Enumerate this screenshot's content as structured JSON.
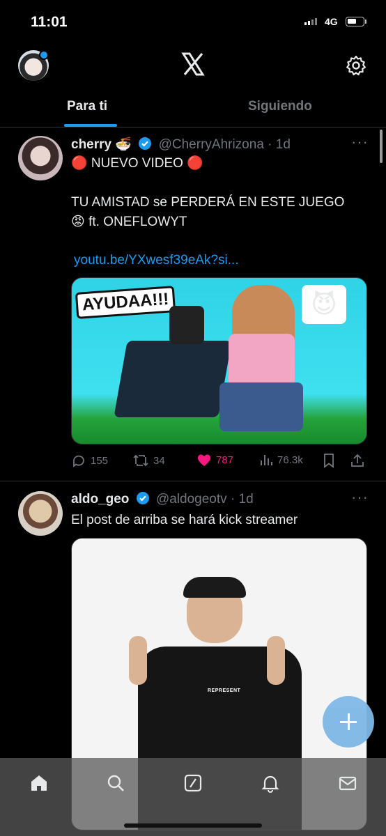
{
  "status_bar": {
    "time": "11:01",
    "network": "4G"
  },
  "header": {
    "logo": "X",
    "settings_icon": "gear-icon"
  },
  "tabs": [
    {
      "label": "Para ti",
      "active": true
    },
    {
      "label": "Siguiendo",
      "active": false
    }
  ],
  "posts": [
    {
      "name": "cherry 🍜",
      "handle": "@CherryAhrizona",
      "time": "· 1d",
      "lines": [
        "🔴 NUEVO VIDEO 🔴",
        "TU AMISTAD se PERDERÁ EN ESTE JUEGO",
        "😡 ft. ONEFLOWYT"
      ],
      "link": "youtu.be/YXwesf39eAk?si...",
      "media_caption": "AYUDAA!!!",
      "actions": {
        "replies": "155",
        "reposts": "34",
        "likes": "787",
        "views": "76.3k"
      }
    },
    {
      "name": "aldo_geo",
      "handle": "@aldogeotv",
      "time": "· 1d",
      "text": "El post de arriba se hará kick streamer",
      "media_shirt_text": "REPRESENT"
    }
  ],
  "colors": {
    "accent": "#1d9bf0",
    "like": "#f91880",
    "muted": "#71767b"
  }
}
